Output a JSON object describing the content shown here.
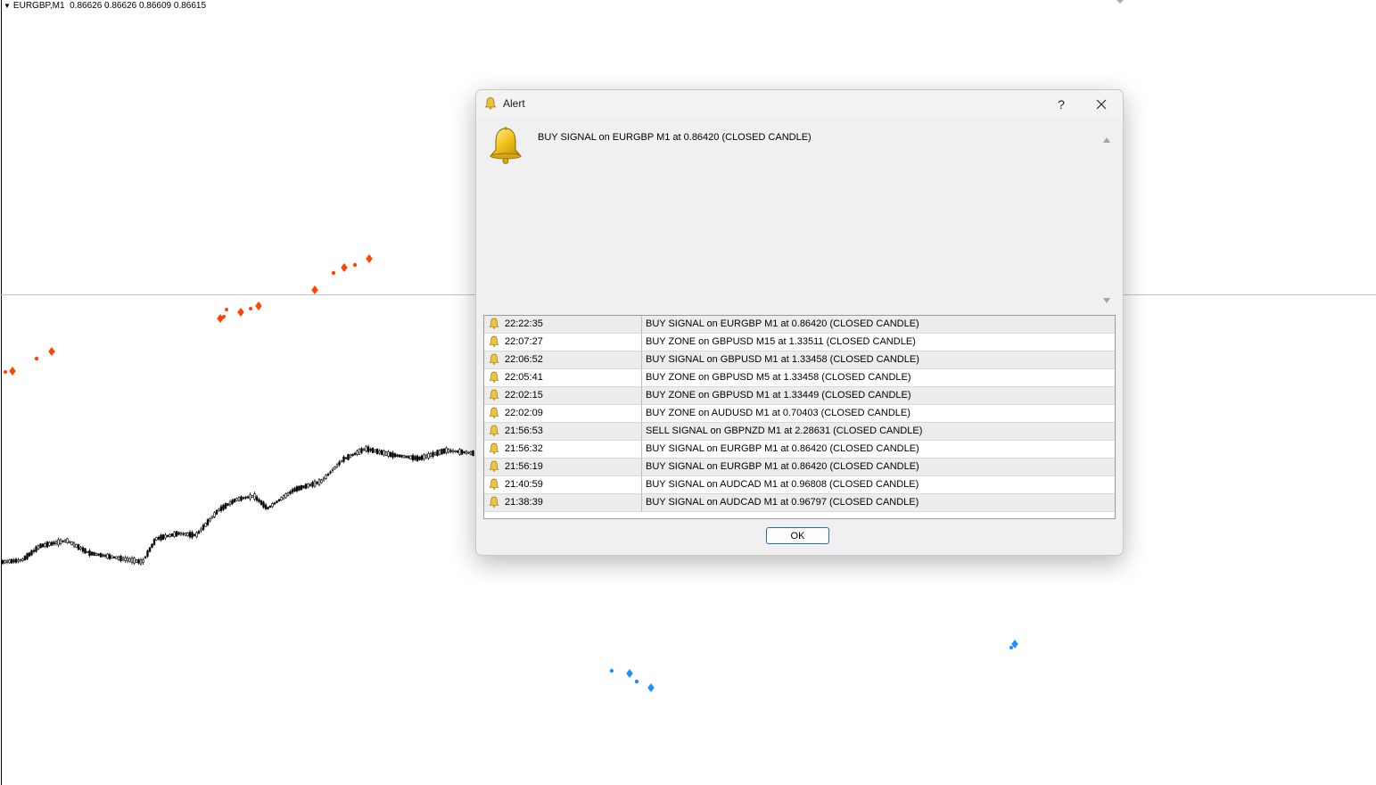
{
  "chart": {
    "symbol": "EURGBP,M1",
    "ohlc": "0.86626 0.86626 0.86609 0.86615",
    "colors": {
      "background": "#ffffff",
      "candles": "#000000",
      "buy_markers": "#ff4500",
      "sell_markers": "#1e90ff",
      "price_line": "#c0c0c0"
    }
  },
  "dialog": {
    "title": "Alert",
    "help_label": "?",
    "message": "BUY SIGNAL on EURGBP M1 at 0.86420 (CLOSED CANDLE)",
    "ok_label": "OK",
    "icons": {
      "title": "bell-icon",
      "message": "bell-icon",
      "row": "bell-icon",
      "close": "close-icon"
    },
    "alerts": [
      {
        "time": "22:22:35",
        "text": "BUY SIGNAL on EURGBP M1 at 0.86420 (CLOSED CANDLE)"
      },
      {
        "time": "22:07:27",
        "text": "BUY ZONE on GBPUSD M15 at 1.33511 (CLOSED CANDLE)"
      },
      {
        "time": "22:06:52",
        "text": "BUY SIGNAL on GBPUSD M1 at 1.33458 (CLOSED CANDLE)"
      },
      {
        "time": "22:05:41",
        "text": "BUY ZONE on GBPUSD M5 at 1.33458 (CLOSED CANDLE)"
      },
      {
        "time": "22:02:15",
        "text": "BUY ZONE on GBPUSD M1 at 1.33449 (CLOSED CANDLE)"
      },
      {
        "time": "22:02:09",
        "text": "BUY ZONE on AUDUSD M1 at 0.70403 (CLOSED CANDLE)"
      },
      {
        "time": "21:56:53",
        "text": "SELL SIGNAL on GBPNZD M1 at 2.28631 (CLOSED CANDLE)"
      },
      {
        "time": "21:56:32",
        "text": "BUY SIGNAL on EURGBP M1 at 0.86420 (CLOSED CANDLE)"
      },
      {
        "time": "21:56:19",
        "text": "BUY SIGNAL on EURGBP M1 at 0.86420 (CLOSED CANDLE)"
      },
      {
        "time": "21:40:59",
        "text": "BUY SIGNAL on AUDCAD M1 at 0.96808 (CLOSED CANDLE)"
      },
      {
        "time": "21:38:39",
        "text": "BUY SIGNAL on AUDCAD M1 at 0.96797 (CLOSED CANDLE)"
      }
    ]
  }
}
